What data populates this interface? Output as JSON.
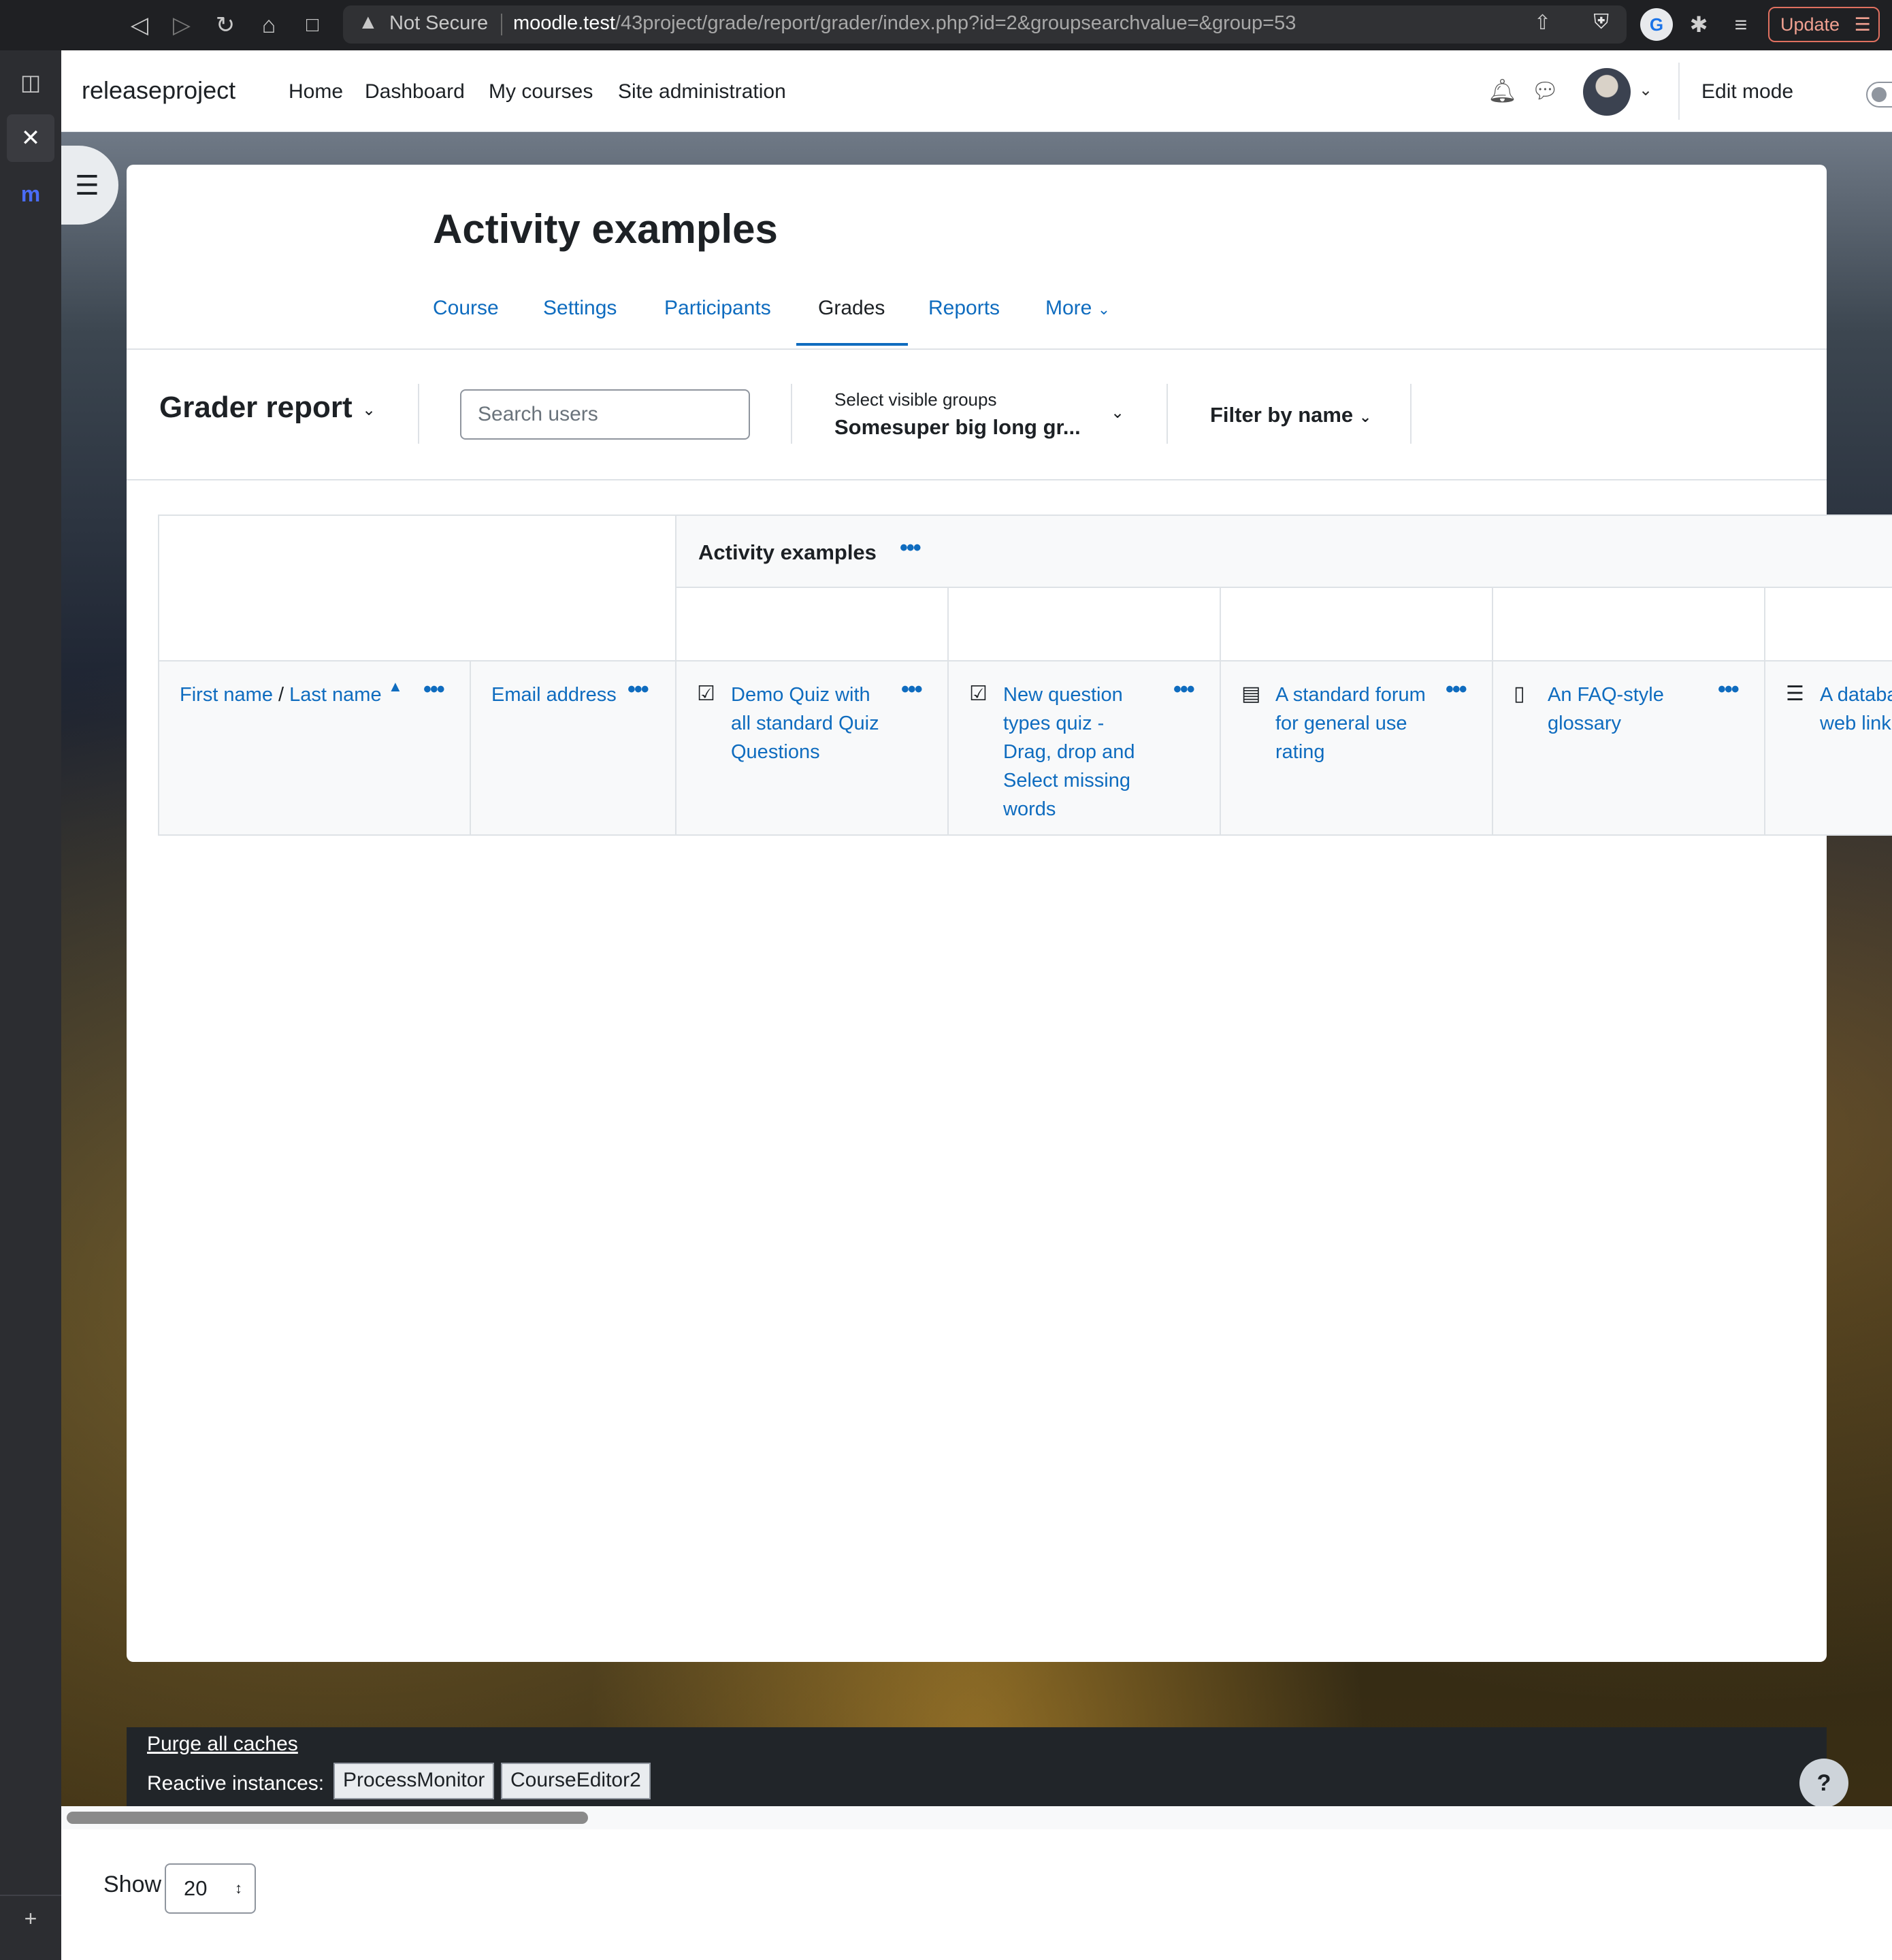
{
  "browser": {
    "warning_text": "Not Secure",
    "url_host": "moodle.test",
    "url_path": "/43project/grade/report/grader/index.php?id=2&groupsearchvalue=&group=53",
    "update_label": "Update",
    "icons": [
      "back-icon",
      "forward-icon",
      "reload-icon",
      "home-icon",
      "bookmark-icon",
      "share-icon",
      "brave-shield-icon",
      "extensions-icon",
      "reading-list-icon"
    ]
  },
  "site": {
    "brand": "releaseproject",
    "nav": [
      "Home",
      "Dashboard",
      "My courses",
      "Site administration"
    ],
    "edit_mode_label": "Edit mode"
  },
  "course": {
    "title": "Activity examples",
    "tabs": [
      "Course",
      "Settings",
      "Participants",
      "Grades",
      "Reports",
      "More"
    ],
    "active_tab": "Grades"
  },
  "toolbar": {
    "report_title": "Grader report",
    "search_placeholder": "Search users",
    "groups_label": "Select visible groups",
    "groups_value": "Somesuper big long gr...",
    "filter_label": "Filter by name"
  },
  "table": {
    "category_title": "Activity examples",
    "first_name": "First name",
    "name_sep": "/",
    "last_name": "Last name",
    "email": "Email address",
    "activities": [
      {
        "name": "Demo Quiz with all standard Quiz Questions",
        "lines": [
          "Demo Quiz with",
          "all standard Quiz",
          "Questions"
        ],
        "icon": "quiz-icon"
      },
      {
        "name": "New question types quiz - Drag, drop and Select missing words",
        "lines": [
          "New question",
          "types quiz -",
          "Drag, drop and",
          "Select missing",
          "words"
        ],
        "icon": "quiz-icon"
      },
      {
        "name": "A standard forum for general use rating",
        "lines": [
          "A standard forum",
          "for general use",
          "rating"
        ],
        "icon": "forum-icon"
      },
      {
        "name": "An FAQ-style glossary",
        "lines": [
          "An FAQ-style",
          "glossary"
        ],
        "icon": "glossary-icon"
      },
      {
        "name": "A databa web link",
        "lines": [
          "A databa",
          "web link"
        ],
        "icon": "database-icon"
      }
    ]
  },
  "footer": {
    "purge_link": "Purge all caches",
    "reactive_label": "Reactive instances:",
    "instances": [
      "ProcessMonitor",
      "CourseEditor2"
    ],
    "help": "?"
  },
  "paging": {
    "show_label": "Show",
    "per_page": "20"
  }
}
